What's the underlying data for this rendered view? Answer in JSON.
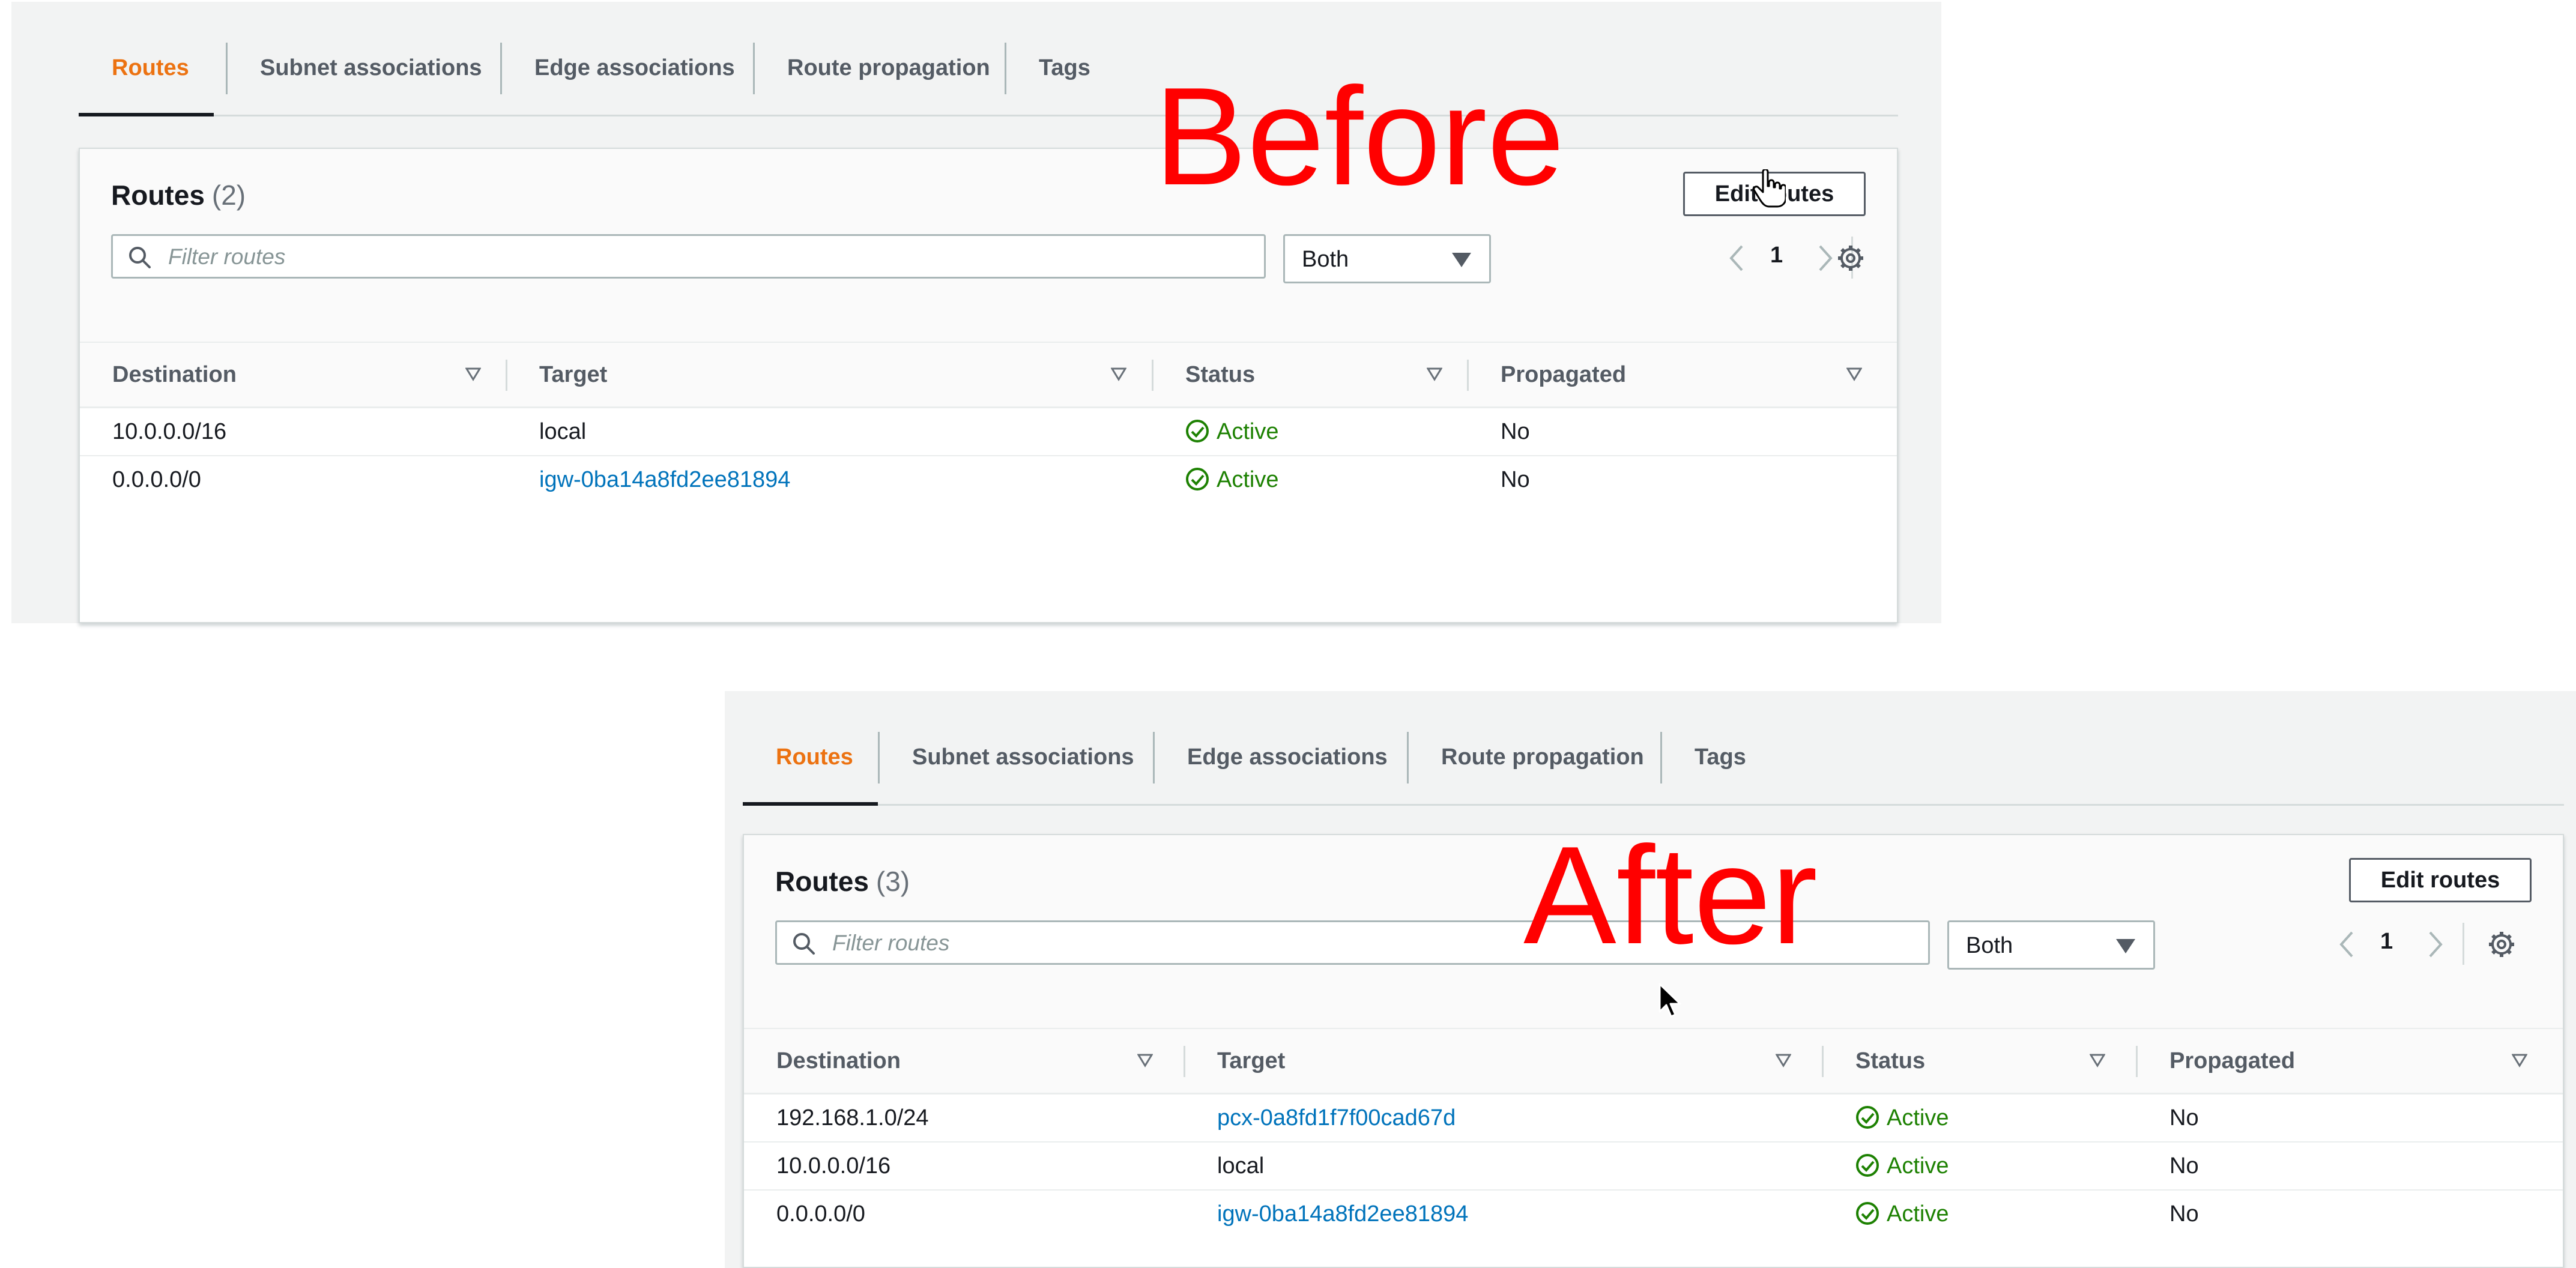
{
  "before": {
    "overlay_label": "Before",
    "tabs": [
      {
        "label": "Routes",
        "active": true
      },
      {
        "label": "Subnet associations",
        "active": false
      },
      {
        "label": "Edge associations",
        "active": false
      },
      {
        "label": "Route propagation",
        "active": false
      },
      {
        "label": "Tags",
        "active": false
      }
    ],
    "routes_title": "Routes",
    "routes_count": "(2)",
    "edit_button_label": "Edit routes",
    "filter_placeholder": "Filter routes",
    "select_value": "Both",
    "page_number": "1",
    "columns": [
      "Destination",
      "Target",
      "Status",
      "Propagated"
    ],
    "rows": [
      {
        "destination": "10.0.0.0/16",
        "target": "local",
        "status": "Active",
        "propagated": "No"
      },
      {
        "destination": "0.0.0.0/0",
        "target": "igw-0ba14a8fd2ee81894",
        "status": "Active",
        "propagated": "No"
      }
    ]
  },
  "after": {
    "overlay_label": "After",
    "tabs": [
      {
        "label": "Routes",
        "active": true
      },
      {
        "label": "Subnet associations",
        "active": false
      },
      {
        "label": "Edge associations",
        "active": false
      },
      {
        "label": "Route propagation",
        "active": false
      },
      {
        "label": "Tags",
        "active": false
      }
    ],
    "routes_title": "Routes",
    "routes_count": "(3)",
    "edit_button_label": "Edit routes",
    "filter_placeholder": "Filter routes",
    "select_value": "Both",
    "page_number": "1",
    "columns": [
      "Destination",
      "Target",
      "Status",
      "Propagated"
    ],
    "rows": [
      {
        "destination": "192.168.1.0/24",
        "target": "pcx-0a8fd1f7f00cad67d",
        "status": "Active",
        "propagated": "No"
      },
      {
        "destination": "10.0.0.0/16",
        "target": "local",
        "status": "Active",
        "propagated": "No"
      },
      {
        "destination": "0.0.0.0/0",
        "target": "igw-0ba14a8fd2ee81894",
        "status": "Active",
        "propagated": "No"
      }
    ]
  },
  "icons": {
    "search": "search-icon",
    "dropdown": "caret-down-icon",
    "prev": "chevron-left-icon",
    "next": "chevron-right-icon",
    "settings": "gear-icon",
    "sort": "sort-triangle-icon",
    "status": "check-circle-icon",
    "hand_cursor": "hand-pointer-cursor-icon",
    "arrow_cursor": "arrow-pointer-cursor-icon"
  },
  "colors": {
    "tab_active": "#ec7211",
    "link": "#0073bb",
    "status_active": "#1d8102",
    "overlay_label": "#ff0000",
    "panel_background": "#f2f3f3"
  }
}
